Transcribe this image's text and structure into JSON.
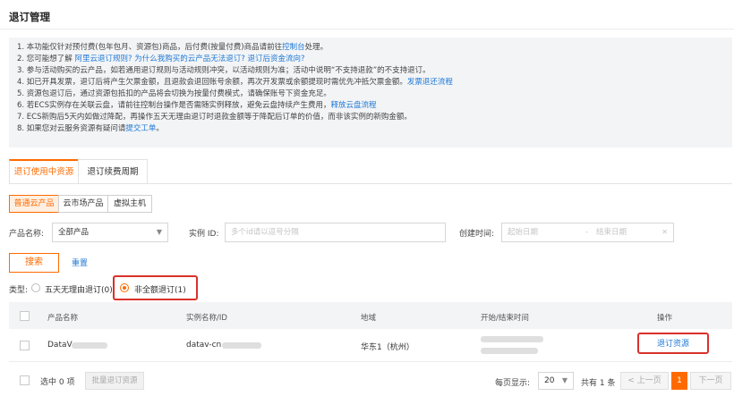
{
  "page": {
    "title": "退订管理"
  },
  "notice": {
    "lines": [
      {
        "pre": "1. 本功能仅针对预付费(包年包月、资源包)商品，后付费(按量付费)商品请前往",
        "link": "控制台",
        "post": "处理。"
      },
      {
        "pre": "2. 您可能想了解 ",
        "link": "阿里云退订规则?    为什么我购买的云产品无法退订?    退订后资金流向?",
        "post": ""
      },
      {
        "pre": "3. 参与活动购买的云产品，如若通用退订规则与活动规则冲突，以活动规则为准；活动中说明“不支持退款”的不支持退订。",
        "link": "",
        "post": ""
      },
      {
        "pre": "4. 如已开具发票，退订后将产生欠票金额，且退款会退回账号余额，再次开发票或余额提现时需优先冲抵欠票金额。",
        "link": "发票退还流程",
        "post": ""
      },
      {
        "pre": "5. 资源包退订后，通过资源包抵扣的产品将会切换为按量付费模式，请确保账号下资金充足。",
        "link": "",
        "post": ""
      },
      {
        "pre": "6. 若ECS实例存在关联云盘，请前往控制台操作是否需随实例释放，避免云盘持续产生费用，",
        "link": "释放云盘流程",
        "post": ""
      },
      {
        "pre": "7. ECS新购后5天内如做过降配，再操作五天无理由退订时退款金额等于降配后订单的价值，而非该实例的新购金额。",
        "link": "",
        "post": ""
      },
      {
        "pre": "8. 如果您对云服务资源有疑问请",
        "link": "提交工单",
        "post": "。"
      }
    ]
  },
  "tabs": [
    {
      "label": "退订使用中资源",
      "active": true
    },
    {
      "label": "退订续费周期",
      "active": false
    }
  ],
  "segments": [
    {
      "label": "普通云产品",
      "active": true
    },
    {
      "label": "云市场产品",
      "active": false
    },
    {
      "label": "虚拟主机",
      "active": false
    }
  ],
  "filters": {
    "product_label": "产品名称:",
    "product_value": "全部产品",
    "instance_label": "实例 ID:",
    "instance_placeholder": "多个id请以逗号分隔",
    "time_label": "创建时间:",
    "start_placeholder": "起始日期",
    "dash": "-",
    "end_placeholder": "结束日期"
  },
  "actions": {
    "search": "搜索",
    "reset": "重置"
  },
  "type_filter": {
    "label": "类型:",
    "options": [
      {
        "label": "五天无理由退订(0)",
        "checked": false
      },
      {
        "label": "非全额退订(1)",
        "checked": true
      }
    ]
  },
  "table": {
    "columns": [
      "产品名称",
      "实例名称/ID",
      "地域",
      "开始/结束时间",
      "操作"
    ],
    "rows": [
      {
        "product": "DataV",
        "instance": "datav-cn",
        "region": "华东1（杭州）",
        "action": "退订资源"
      }
    ]
  },
  "footer": {
    "selected": "选中 0 项",
    "batch": "批量退订资源",
    "per_page_label": "每页显示:",
    "per_page": "20",
    "total": "共有 1 条",
    "prev": "< 上一页",
    "page": "1",
    "next": "下一页"
  },
  "colors": {
    "accent": "#ff6a00",
    "link": "#1f7ad6",
    "highlight": "#d9312a"
  }
}
